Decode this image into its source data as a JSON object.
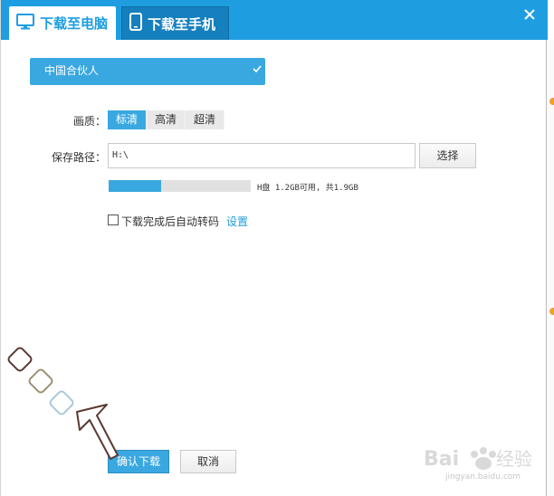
{
  "tabs": [
    {
      "label": "下载至电脑",
      "icon": "monitor-icon",
      "active": true
    },
    {
      "label": "下载至手机",
      "icon": "phone-icon",
      "active": false
    }
  ],
  "close_icon": "close-icon",
  "partner": {
    "label": "中国合伙人",
    "icon": "checkmark-icon"
  },
  "quality": {
    "label": "画质：",
    "options": [
      "标清",
      "高清",
      "超清"
    ],
    "selected": "标清"
  },
  "save_path": {
    "label": "保存路径：",
    "value": "H:\\",
    "choose_label": "选择"
  },
  "disk": {
    "text": "H盘 1.2GB可用, 共1.9GB",
    "used_fraction": 0.37
  },
  "auto_convert": {
    "checked": false,
    "label": "下载完成后自动转码",
    "settings_label": "设置"
  },
  "buttons": {
    "confirm": "确认下载",
    "cancel": "取消"
  },
  "watermark": {
    "site": "jingyan.baidu.com"
  },
  "colors": {
    "accent": "#1e9ee0",
    "button_blue": "#3aa8e0",
    "tab_dark": "#1580bd"
  }
}
